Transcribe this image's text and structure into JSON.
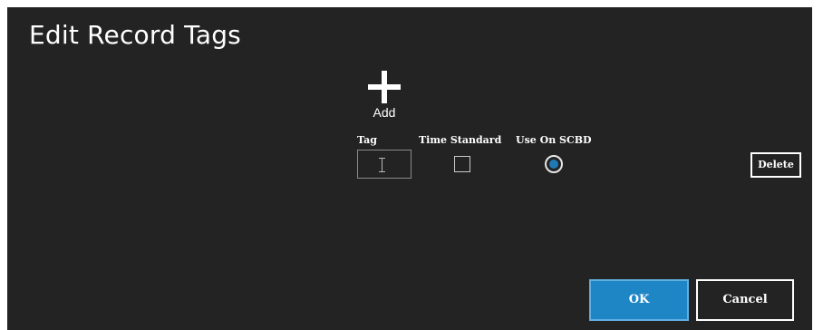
{
  "dialog": {
    "title": "Edit Record Tags"
  },
  "toolbar": {
    "add_label": "Add",
    "add_icon": "plus-icon"
  },
  "columns": {
    "tag": "Tag",
    "time_standard": "Time Standard",
    "use_on_scbd": "Use On SCBD"
  },
  "row": {
    "tag_value": "",
    "time_standard_checked": false,
    "use_on_scbd_selected": true,
    "delete_label": "Delete"
  },
  "buttons": {
    "ok_label": "OK",
    "cancel_label": "Cancel"
  },
  "colors": {
    "background": "#232323",
    "accent": "#1f86c6",
    "text": "#ffffff"
  }
}
